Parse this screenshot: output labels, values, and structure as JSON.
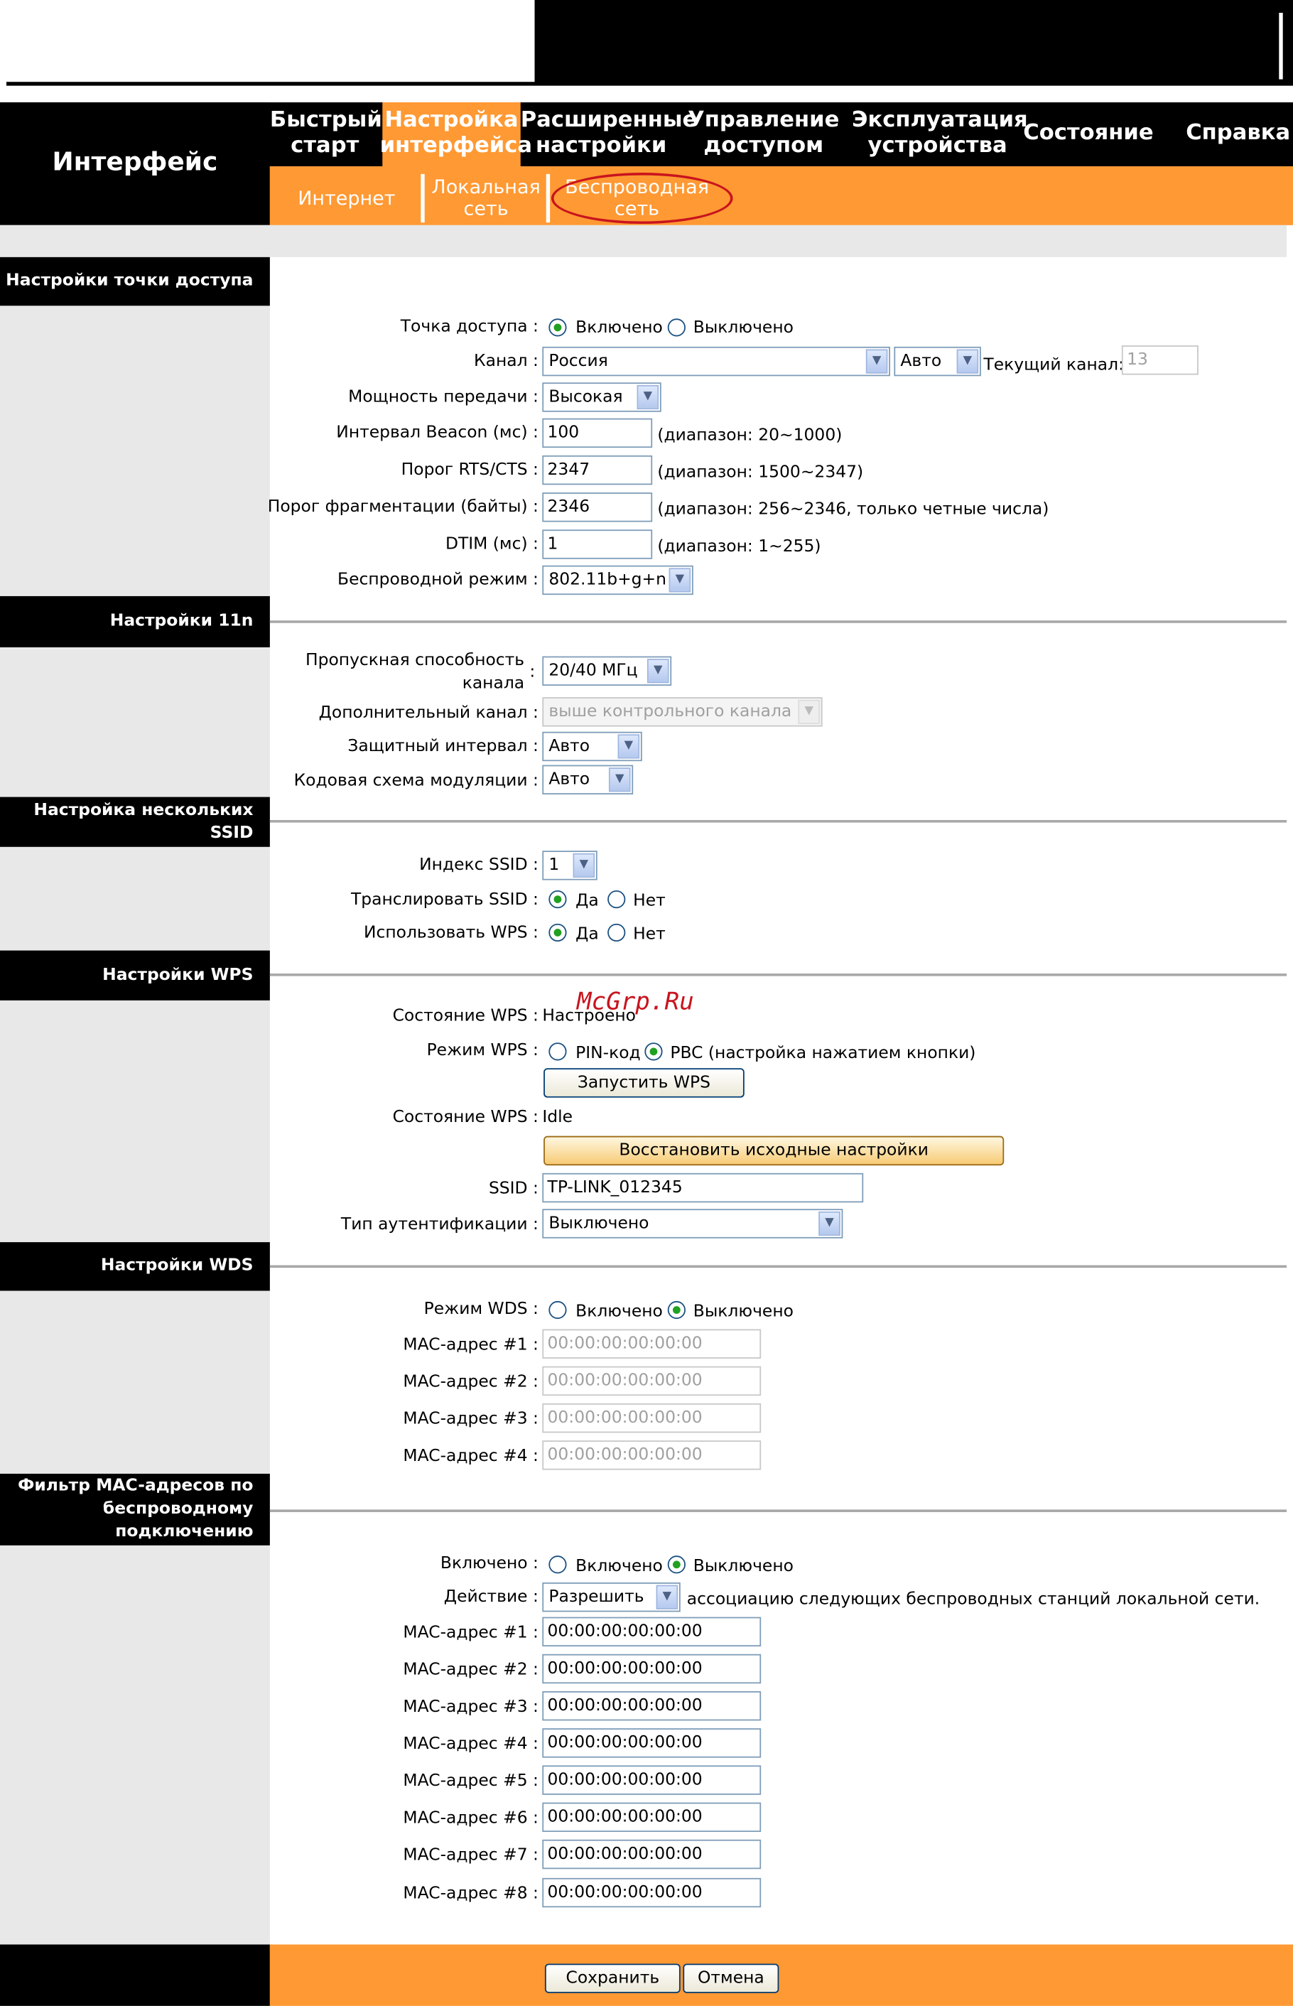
{
  "nav": {
    "brand": "Интерфейс",
    "tabs": [
      {
        "l1": "Быстрый",
        "l2": "старт"
      },
      {
        "l1": "Настройка",
        "l2": "интерфейса"
      },
      {
        "l1": "Расширенные",
        "l2": "настройки"
      },
      {
        "l1": "Управление",
        "l2": "доступом"
      },
      {
        "l1": "Эксплуатация",
        "l2": "устройства"
      },
      {
        "l1": "Состояние",
        "l2": ""
      },
      {
        "l1": "Справка",
        "l2": ""
      }
    ],
    "subtabs": [
      {
        "l1": "Интернет",
        "l2": ""
      },
      {
        "l1": "Локальная",
        "l2": "сеть"
      },
      {
        "l1": "Беспроводная",
        "l2": "сеть"
      }
    ]
  },
  "colors": {
    "accent": "#ff9933",
    "header": "#000000",
    "sidebar": "#e8e8e8"
  },
  "watermark": "McGrp.Ru",
  "ap": {
    "title": "Настройки точки доступа",
    "ap_label": "Точка доступа :",
    "on": "Включено",
    "off": "Выключено",
    "channel_label": "Канал :",
    "channel_value": "Россия",
    "channel_auto": "Авто",
    "current_channel_label": "Текущий канал:",
    "current_channel_value": "13",
    "power_label": "Мощность передачи :",
    "power_value": "Высокая",
    "beacon_label": "Интервал Beacon (мс) :",
    "beacon_value": "100",
    "beacon_range": "(диапазон: 20~1000)",
    "rts_label": "Порог RTS/CTS :",
    "rts_value": "2347",
    "rts_range": "(диапазон: 1500~2347)",
    "frag_label": "Порог фрагментации (байты) :",
    "frag_value": "2346",
    "frag_range": "(диапазон: 256~2346, только четные числа)",
    "dtim_label": "DTIM (мс) :",
    "dtim_value": "1",
    "dtim_range": "(диапазон: 1~255)",
    "mode_label": "Беспроводной режим :",
    "mode_value": "802.11b+g+n"
  },
  "n11": {
    "title": "Настройки 11n",
    "bw_label1": "Пропускная способность",
    "bw_label2": "канала",
    "bw_value": "20/40 МГц",
    "ext_label": "Дополнительный канал :",
    "ext_value": "выше контрольного канала",
    "gi_label": "Защитный интервал :",
    "gi_value": "Авто",
    "mcs_label": "Кодовая схема модуляции :",
    "mcs_value": "Авто"
  },
  "ssid": {
    "title1": "Настройка нескольких",
    "title2": "SSID",
    "index_label": "Индекс SSID :",
    "index_value": "1",
    "broadcast_label": "Транслировать SSID :",
    "wps_label": "Использовать WPS :",
    "yes": "Да",
    "no": "Нет"
  },
  "wps": {
    "title": "Настройки WPS",
    "state_label": "Состояние WPS :",
    "state_value": "Настроено",
    "mode_label": "Режим WPS :",
    "pin": "PIN-код",
    "pbc": "PBC (настройка нажатием кнопки)",
    "start_button": "Запустить WPS",
    "status_label": "Состояние WPS :",
    "status_value": "Idle",
    "reset_button": "Восстановить исходные настройки",
    "ssid_label": "SSID :",
    "ssid_value": "TP-LINK_012345",
    "auth_label": "Тип аутентификации :",
    "auth_value": "Выключено"
  },
  "wds": {
    "title": "Настройки WDS",
    "mode_label": "Режим WDS :",
    "on": "Включено",
    "off": "Выключено",
    "macs": [
      {
        "label": "MAC-адрес #1 :",
        "value": "00:00:00:00:00:00"
      },
      {
        "label": "MAC-адрес #2 :",
        "value": "00:00:00:00:00:00"
      },
      {
        "label": "MAC-адрес #3 :",
        "value": "00:00:00:00:00:00"
      },
      {
        "label": "MAC-адрес #4 :",
        "value": "00:00:00:00:00:00"
      }
    ]
  },
  "filter": {
    "title1": "Фильтр MAC-адресов по",
    "title2": "беспроводному",
    "title3": "подключению",
    "enabled_label": "Включено :",
    "on": "Включено",
    "off": "Выключено",
    "action_label": "Действие :",
    "action_value": "Разрешить",
    "action_text": "ассоциацию следующих беспроводных станций локальной сети.",
    "macs": [
      {
        "label": "MAC-адрес #1 :",
        "value": "00:00:00:00:00:00"
      },
      {
        "label": "MAC-адрес #2 :",
        "value": "00:00:00:00:00:00"
      },
      {
        "label": "MAC-адрес #3 :",
        "value": "00:00:00:00:00:00"
      },
      {
        "label": "MAC-адрес #4 :",
        "value": "00:00:00:00:00:00"
      },
      {
        "label": "MAC-адрес #5 :",
        "value": "00:00:00:00:00:00"
      },
      {
        "label": "MAC-адрес #6 :",
        "value": "00:00:00:00:00:00"
      },
      {
        "label": "MAC-адрес #7 :",
        "value": "00:00:00:00:00:00"
      },
      {
        "label": "MAC-адрес #8 :",
        "value": "00:00:00:00:00:00"
      }
    ]
  },
  "footer": {
    "save": "Сохранить",
    "cancel": "Отмена"
  }
}
